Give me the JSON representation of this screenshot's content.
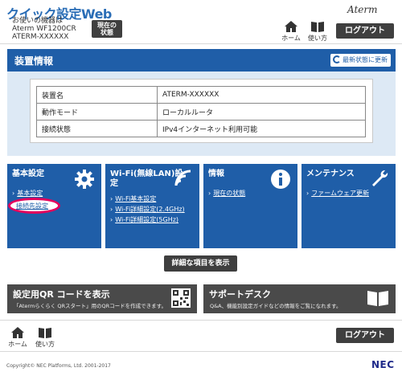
{
  "header": {
    "app_title": "クイック設定Web",
    "device_line1": "お使いの機器は",
    "device_line2": "Aterm WF1200CR",
    "device_line3": "ATERM-XXXXXX",
    "now_state_line1": "現在の",
    "now_state_line2": "状態",
    "brand": "Aterm",
    "home_label": "ホーム",
    "usage_label": "使い方",
    "logout_label": "ログアウト"
  },
  "device_panel": {
    "title": "装置情報",
    "refresh_label": "最新状態に更新",
    "rows": [
      {
        "key": "装置名",
        "value": "ATERM-XXXXXX"
      },
      {
        "key": "動作モード",
        "value": "ローカルルータ"
      },
      {
        "key": "接続状態",
        "value": "IPv4インターネット利用可能"
      }
    ]
  },
  "tiles": {
    "basic": {
      "title": "基本設定",
      "links": [
        "基本設定",
        "接続先設定"
      ],
      "icon": "gear-icon"
    },
    "wifi": {
      "title_line1": "Wi-Fi(無線LAN)設",
      "title_line2": "定",
      "links": [
        "Wi-Fi基本設定",
        "Wi-Fi詳細設定(2.4GHz)",
        "Wi-Fi詳細設定(5GHz)"
      ],
      "icon": "wifi-icon"
    },
    "info": {
      "title": "情報",
      "links": [
        "現在の状態"
      ],
      "icon": "info-icon"
    },
    "maintenance": {
      "title": "メンテナンス",
      "links": [
        "ファームウェア更新"
      ],
      "icon": "wrench-icon"
    }
  },
  "detail_button_label": "詳細な項目を表示",
  "qr_banner": {
    "title": "設定用QR コードを表示",
    "desc": "「Atermらくらく QRスタート」用のQRコードを作成できます。",
    "icon": "qr-code-icon"
  },
  "support_banner": {
    "title": "サポートデスク",
    "desc": "Q&A、機能別設定ガイドなどの情報をご覧になれます。",
    "icon": "book-icon"
  },
  "footer": {
    "home_label": "ホーム",
    "usage_label": "使い方",
    "logout_label": "ログアウト",
    "copyright": "Copyright© NEC Platforms, Ltd. 2001-2017",
    "nec_logo": "NEC"
  },
  "colors": {
    "primary_blue": "#1f5ea8",
    "light_blue_bg": "#dde9f5",
    "dark_button": "#3f3f3f",
    "highlight": "#e4005c"
  }
}
